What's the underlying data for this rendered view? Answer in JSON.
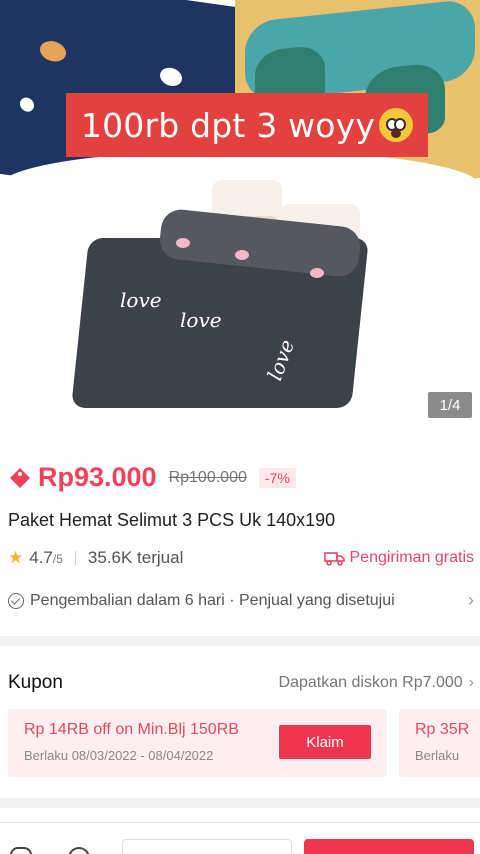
{
  "overlay": {
    "caption": "100rb dpt 3 woyy",
    "emoji": "scream-face-emoji"
  },
  "gallery": {
    "counter": "1/4"
  },
  "price": {
    "current": "Rp93.000",
    "original": "Rp100.000",
    "discount": "-7%",
    "accent": "#f3415a"
  },
  "product": {
    "title": "Paket Hemat Selimut 3 PCS Uk 140x190"
  },
  "stats": {
    "rating": "4.7",
    "rating_max": "/5",
    "sold": "35.6K terjual",
    "shipping": "Pengiriman gratis"
  },
  "policy": {
    "text": "Pengembalian dalam 6 hari · Penjual yang disetujui"
  },
  "coupon": {
    "title": "Kupon",
    "link": "Dapatkan diskon Rp7.000",
    "cards": [
      {
        "title": "Rp 14RB off on Min.Blj 150RB",
        "dates": "Berlaku 08/03/2022 - 08/04/2022",
        "button": "Klaim"
      },
      {
        "title": "Rp 35R",
        "dates": "Berlaku"
      }
    ]
  },
  "colors": {
    "primary": "#f0354f",
    "banner": "#e2413f",
    "star": "#f7b52b"
  },
  "icons": [
    "price-tag-icon",
    "star-icon",
    "truck-icon",
    "check-circle-icon",
    "chevron-right-icon",
    "store-icon",
    "chat-icon"
  ]
}
